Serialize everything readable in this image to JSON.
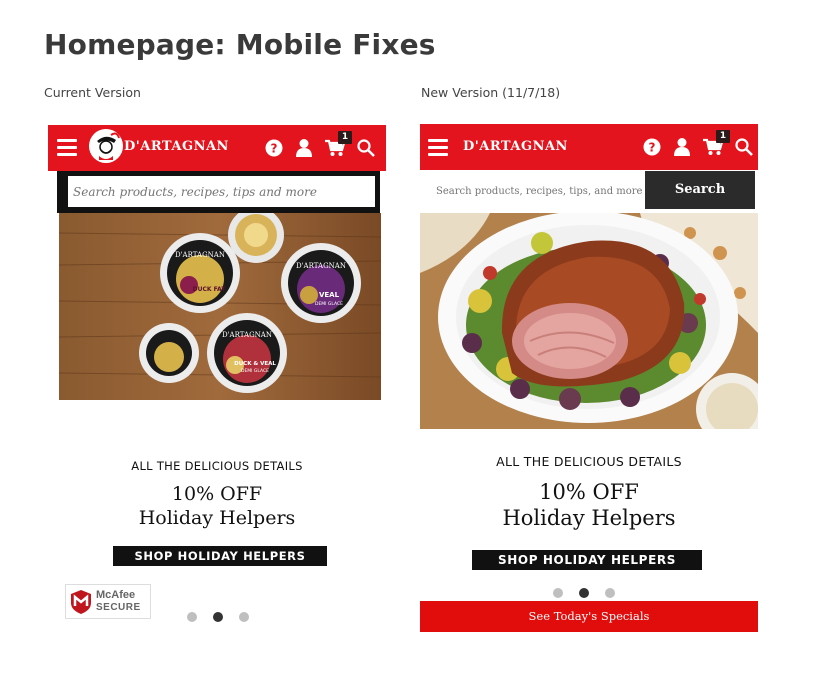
{
  "page_title": "Homepage: Mobile Fixes",
  "current": {
    "label": "Current Version",
    "brand": "D'ARTAGNAN",
    "cart_count": "1",
    "search_placeholder": "Search products, recipes, tips and more",
    "subheading": "ALL THE DELICIOUS DETAILS",
    "offer_line1": "10% OFF",
    "offer_line2": "Holiday Helpers",
    "cta": "SHOP HOLIDAY HELPERS",
    "mcafee_name": "McAfee",
    "mcafee_secure": "SECURE",
    "carousel": {
      "count": 3,
      "active": 2
    },
    "products": {
      "p1": "DUCK FAT",
      "p2": "VEAL",
      "p2_sub": "DEMI GLACE",
      "p3": "DUCK & VEAL",
      "p3_sub": "DEMI GLACE"
    }
  },
  "new": {
    "label": "New Version (11/7/18)",
    "brand": "D'ARTAGNAN",
    "cart_count": "1",
    "search_placeholder": "Search products, recipes, tips, and more",
    "search_button": "Search",
    "subheading": "ALL THE DELICIOUS DETAILS",
    "offer_line1": "10% OFF",
    "offer_line2": "Holiday Helpers",
    "cta": "SHOP HOLIDAY HELPERS",
    "carousel": {
      "count": 3,
      "active": 2
    },
    "specials": "See Today's Specials"
  },
  "colors": {
    "brand_red": "#e3141d",
    "black": "#111111",
    "search_button": "#2b2b2b",
    "dot_inactive": "#bfbfbf",
    "dot_active": "#333333"
  },
  "icons": [
    "hamburger-icon",
    "help-icon",
    "user-icon",
    "cart-icon",
    "search-icon",
    "mcafee-shield-icon"
  ]
}
